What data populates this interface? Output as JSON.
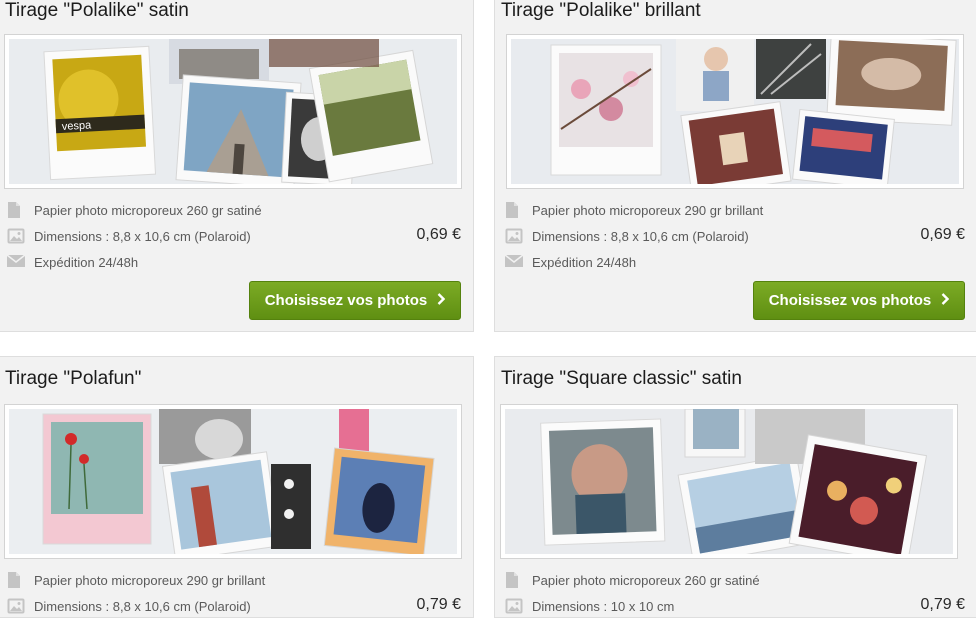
{
  "products": [
    {
      "title": "Tirage \"Polalike\" satin",
      "paper": "Papier photo microporeux 260 gr satiné",
      "dimensions": "Dimensions : 8,8 x 10,6 cm (Polaroid)",
      "shipping": "Expédition 24/48h",
      "price": "0,69 €",
      "button_label": "Choisissez vos photos"
    },
    {
      "title": "Tirage \"Polalike\" brillant",
      "paper": "Papier photo microporeux 290 gr brillant",
      "dimensions": "Dimensions : 8,8 x 10,6 cm (Polaroid)",
      "shipping": "Expédition 24/48h",
      "price": "0,69 €",
      "button_label": "Choisissez vos photos"
    },
    {
      "title": "Tirage \"Polafun\"",
      "paper": "Papier photo microporeux 290 gr brillant",
      "dimensions": "Dimensions : 8,8 x 10,6 cm (Polaroid)",
      "price": "0,79 €"
    },
    {
      "title": "Tirage \"Square classic\" satin",
      "paper": "Papier photo microporeux 260 gr satiné",
      "dimensions": "Dimensions : 10 x 10 cm",
      "price": "0,79 €"
    }
  ],
  "icons": {
    "paper": "document-icon",
    "dimensions": "photo-icon",
    "shipping": "envelope-icon",
    "button": "chevron-right-icon"
  },
  "colors": {
    "button_green": "#6f9d1c",
    "card_background": "#f2f2f2"
  }
}
